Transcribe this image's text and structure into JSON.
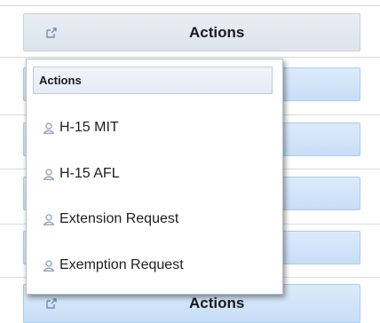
{
  "actions_button": {
    "label": "Actions",
    "icon": "external-link-icon"
  },
  "popup": {
    "header": "Actions",
    "items": [
      {
        "label": "H-15 MIT",
        "icon": "user-icon"
      },
      {
        "label": "H-15 AFL",
        "icon": "user-icon"
      },
      {
        "label": "Extension Request",
        "icon": "user-icon"
      },
      {
        "label": "Exemption Request",
        "icon": "user-icon"
      }
    ]
  },
  "colors": {
    "button_fill": "#c7def6",
    "button_border": "#aecbe8",
    "icon_color": "#8aa4bf"
  }
}
